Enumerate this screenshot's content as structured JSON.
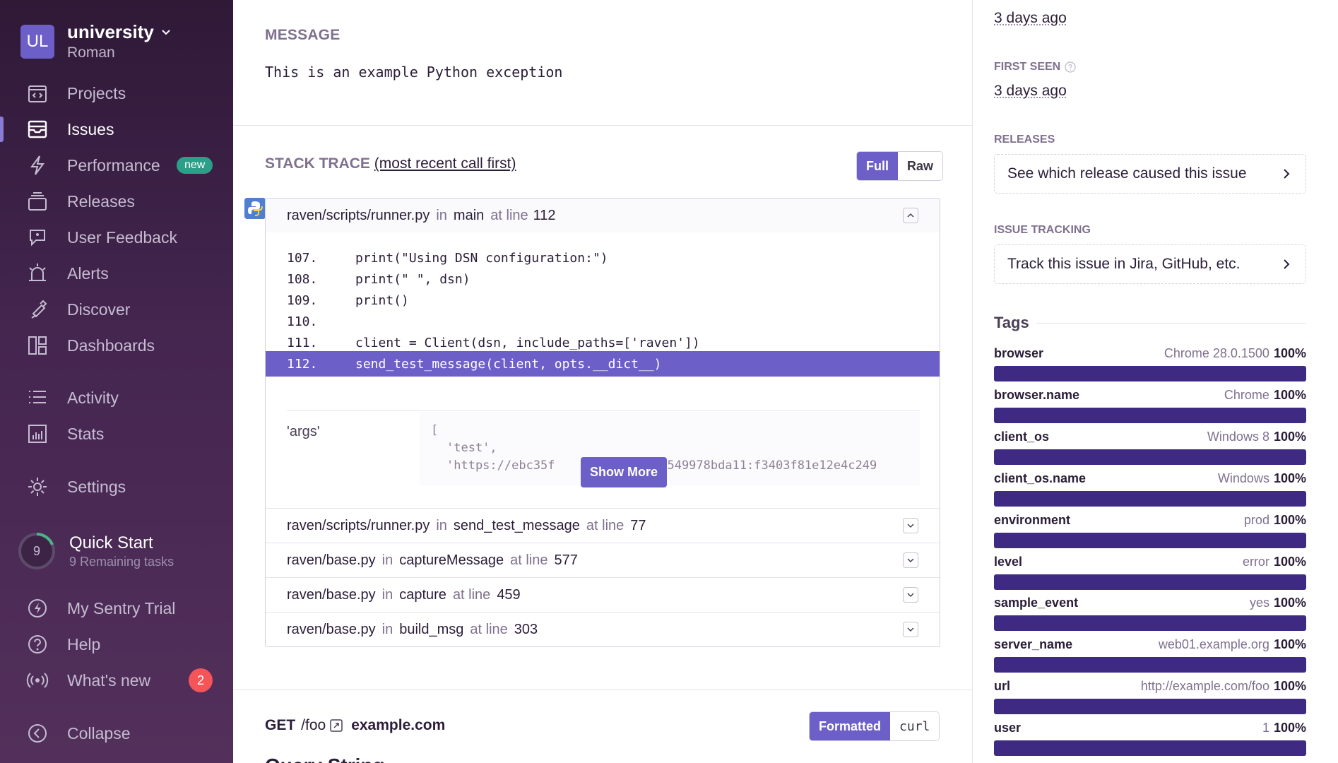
{
  "sidebar": {
    "org_initials": "UL",
    "org_name": "university",
    "user_name": "Roman",
    "items": [
      {
        "label": "Projects",
        "icon": "projects-icon"
      },
      {
        "label": "Issues",
        "icon": "issues-icon",
        "active": true
      },
      {
        "label": "Performance",
        "icon": "performance-icon",
        "badge": "new"
      },
      {
        "label": "Releases",
        "icon": "releases-icon"
      },
      {
        "label": "User Feedback",
        "icon": "user-feedback-icon"
      },
      {
        "label": "Alerts",
        "icon": "alerts-icon"
      },
      {
        "label": "Discover",
        "icon": "discover-icon"
      },
      {
        "label": "Dashboards",
        "icon": "dashboards-icon"
      },
      {
        "label": "Activity",
        "icon": "activity-icon"
      },
      {
        "label": "Stats",
        "icon": "stats-icon"
      },
      {
        "label": "Settings",
        "icon": "settings-icon"
      }
    ],
    "quick_start": {
      "count": "9",
      "title": "Quick Start",
      "subtitle": "9 Remaining tasks"
    },
    "bottom": [
      {
        "label": "My Sentry Trial",
        "icon": "lightning-icon"
      },
      {
        "label": "Help",
        "icon": "help-icon"
      },
      {
        "label": "What's new",
        "icon": "broadcast-icon",
        "badge": "2"
      },
      {
        "label": "Collapse",
        "icon": "collapse-icon"
      }
    ]
  },
  "main": {
    "message_title": "MESSAGE",
    "message_body": "This is an example Python exception",
    "stack_title": "STACK TRACE",
    "stack_order": "(most recent call first)",
    "stack_toggle": [
      "Full",
      "Raw"
    ],
    "frames": [
      {
        "file": "raven/scripts/runner.py",
        "in": "in",
        "fn": "main",
        "at": "at line",
        "line": "112",
        "expanded": true
      },
      {
        "file": "raven/scripts/runner.py",
        "in": "in",
        "fn": "send_test_message",
        "at": "at line",
        "line": "77"
      },
      {
        "file": "raven/base.py",
        "in": "in",
        "fn": "captureMessage",
        "at": "at line",
        "line": "577"
      },
      {
        "file": "raven/base.py",
        "in": "in",
        "fn": "capture",
        "at": "at line",
        "line": "459"
      },
      {
        "file": "raven/base.py",
        "in": "in",
        "fn": "build_msg",
        "at": "at line",
        "line": "303"
      }
    ],
    "code": [
      {
        "ln": "107.",
        "code": "print(\"Using DSN configuration:\")"
      },
      {
        "ln": "108.",
        "code": "print(\" \", dsn)"
      },
      {
        "ln": "109.",
        "code": "print()"
      },
      {
        "ln": "110.",
        "code": ""
      },
      {
        "ln": "111.",
        "code": "client = Client(dsn, include_paths=['raven'])"
      },
      {
        "ln": "112.",
        "code": "send_test_message(client, opts.__dict__)"
      }
    ],
    "vars_label": "'args'",
    "vars_lines": [
      "[",
      "'test',",
      "'https://ebc35f",
      "deac549978bda11:f3403f81e12e4c249"
    ],
    "show_more": "Show More",
    "request": {
      "method": "GET",
      "path": "/foo",
      "host": "example.com",
      "toggle": [
        "Formatted",
        "curl"
      ]
    },
    "query_string_peek": "Query String"
  },
  "right": {
    "last_seen_value": "3 days ago",
    "first_seen_label": "FIRST SEEN",
    "first_seen_value": "3 days ago",
    "releases_label": "RELEASES",
    "releases_cta": "See which release caused this issue",
    "tracking_label": "ISSUE TRACKING",
    "tracking_cta": "Track this issue in Jira, GitHub, etc.",
    "tags_title": "Tags",
    "tags": [
      {
        "key": "browser",
        "value": "Chrome 28.0.1500",
        "pct": "100%",
        "fraction": 1.0
      },
      {
        "key": "browser.name",
        "value": "Chrome",
        "pct": "100%",
        "fraction": 1.0
      },
      {
        "key": "client_os",
        "value": "Windows 8",
        "pct": "100%",
        "fraction": 1.0
      },
      {
        "key": "client_os.name",
        "value": "Windows",
        "pct": "100%",
        "fraction": 1.0
      },
      {
        "key": "environment",
        "value": "prod",
        "pct": "100%",
        "fraction": 1.0
      },
      {
        "key": "level",
        "value": "error",
        "pct": "100%",
        "fraction": 1.0
      },
      {
        "key": "sample_event",
        "value": "yes",
        "pct": "100%",
        "fraction": 1.0
      },
      {
        "key": "server_name",
        "value": "web01.example.org",
        "pct": "100%",
        "fraction": 1.0
      },
      {
        "key": "url",
        "value": "http://example.com/foo",
        "pct": "100%",
        "fraction": 1.0
      },
      {
        "key": "user",
        "value": "1",
        "pct": "100%",
        "fraction": 1.0
      }
    ]
  },
  "colors": {
    "accent": "#6c5fc7",
    "tag_bar": "#3e2a83",
    "badge_new": "#2c9f88",
    "badge_alert": "#f55459"
  }
}
